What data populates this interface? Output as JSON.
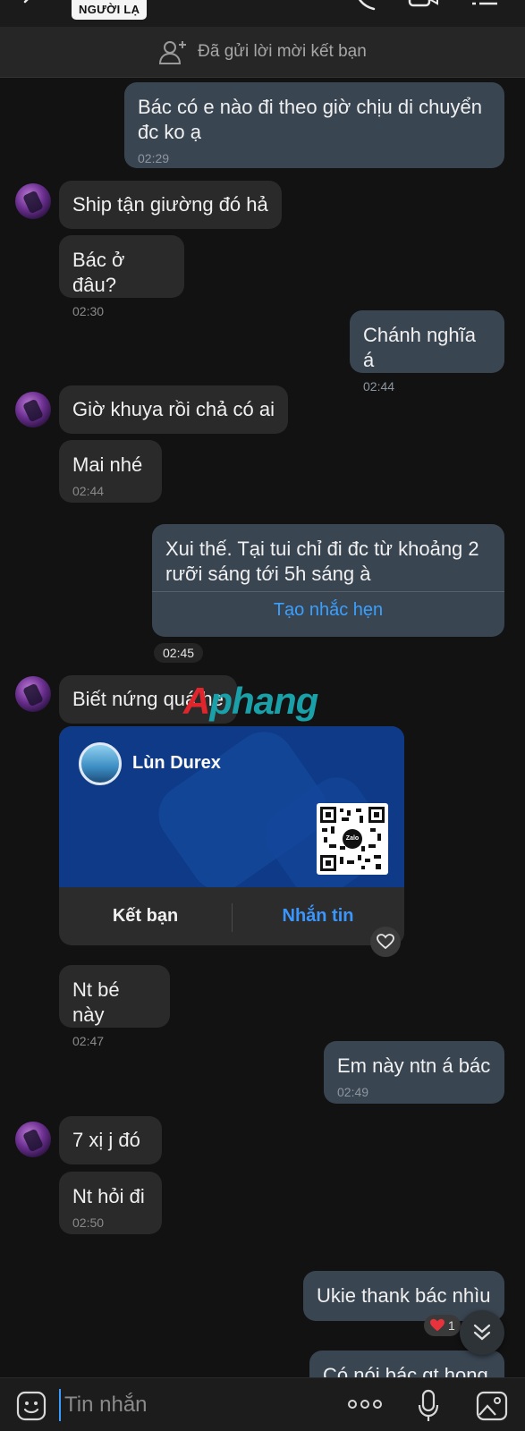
{
  "header": {
    "stranger_badge": "NGƯỜI LẠ"
  },
  "friend_request": {
    "text": "Đã gửi lời mời kết bạn"
  },
  "messages": {
    "m1": {
      "text": "Bác có e nào đi theo giờ chịu di chuyển đc ko ạ",
      "time": "02:29"
    },
    "m2": {
      "text": "Ship tận giường đó hả"
    },
    "m3": {
      "text": "Bác ở đâu?",
      "time": "02:30"
    },
    "m4": {
      "text": "Chánh nghĩa á",
      "time": "02:44"
    },
    "m5": {
      "text": "Giờ khuya rồi chả có ai"
    },
    "m6": {
      "text": "Mai nhé",
      "time": "02:44"
    },
    "m7": {
      "text": "Xui thế. Tại tui chỉ đi đc từ khoảng 2 rưỡi sáng tới 5h sáng à",
      "reminder_link": "Tạo nhắc hẹn"
    },
    "time_chip": "02:45",
    "m8": {
      "text": "Biết nứng quá he"
    },
    "m9": {
      "text": "Nt bé này",
      "time": "02:47"
    },
    "m10": {
      "text": "Em này ntn á bác",
      "time": "02:49"
    },
    "m11": {
      "text": "7 xị j đó"
    },
    "m12": {
      "text": "Nt hỏi đi",
      "time": "02:50"
    },
    "m13": {
      "text": "Ukie thank bác nhìu"
    },
    "m14": {
      "text": "Có nói bác gt hong"
    }
  },
  "contact_card": {
    "name": "Lùn Durex",
    "qr_label": "Zalo",
    "add_friend_label": "Kết bạn",
    "message_label": "Nhắn tin"
  },
  "reaction": {
    "count": "1"
  },
  "watermark": {
    "part1": "A",
    "part2": "phang"
  },
  "input": {
    "placeholder": "Tin nhắn"
  },
  "colors": {
    "background": "#121212",
    "incoming_bubble": "#2a2a2a",
    "outgoing_bubble": "#3a4552",
    "accent_blue": "#3a96ff",
    "card_blue": "#0e3a88"
  }
}
